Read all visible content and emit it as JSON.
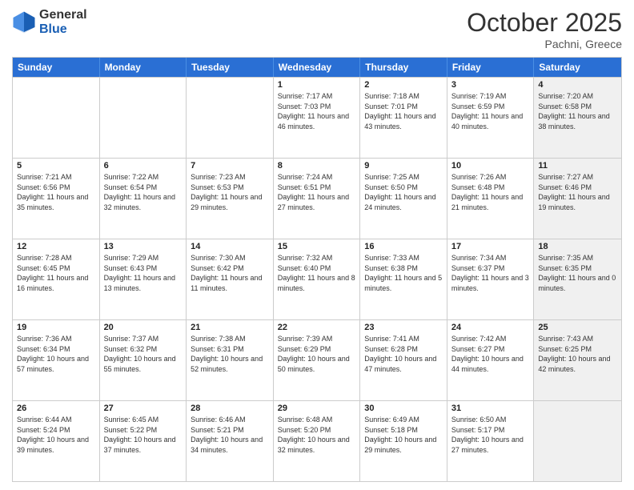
{
  "logo": {
    "general": "General",
    "blue": "Blue"
  },
  "header": {
    "month": "October 2025",
    "location": "Pachni, Greece"
  },
  "days": [
    "Sunday",
    "Monday",
    "Tuesday",
    "Wednesday",
    "Thursday",
    "Friday",
    "Saturday"
  ],
  "rows": [
    [
      {
        "day": "",
        "info": "",
        "shaded": false
      },
      {
        "day": "",
        "info": "",
        "shaded": false
      },
      {
        "day": "",
        "info": "",
        "shaded": false
      },
      {
        "day": "1",
        "info": "Sunrise: 7:17 AM\nSunset: 7:03 PM\nDaylight: 11 hours and 46 minutes.",
        "shaded": false
      },
      {
        "day": "2",
        "info": "Sunrise: 7:18 AM\nSunset: 7:01 PM\nDaylight: 11 hours and 43 minutes.",
        "shaded": false
      },
      {
        "day": "3",
        "info": "Sunrise: 7:19 AM\nSunset: 6:59 PM\nDaylight: 11 hours and 40 minutes.",
        "shaded": false
      },
      {
        "day": "4",
        "info": "Sunrise: 7:20 AM\nSunset: 6:58 PM\nDaylight: 11 hours and 38 minutes.",
        "shaded": true
      }
    ],
    [
      {
        "day": "5",
        "info": "Sunrise: 7:21 AM\nSunset: 6:56 PM\nDaylight: 11 hours and 35 minutes.",
        "shaded": false
      },
      {
        "day": "6",
        "info": "Sunrise: 7:22 AM\nSunset: 6:54 PM\nDaylight: 11 hours and 32 minutes.",
        "shaded": false
      },
      {
        "day": "7",
        "info": "Sunrise: 7:23 AM\nSunset: 6:53 PM\nDaylight: 11 hours and 29 minutes.",
        "shaded": false
      },
      {
        "day": "8",
        "info": "Sunrise: 7:24 AM\nSunset: 6:51 PM\nDaylight: 11 hours and 27 minutes.",
        "shaded": false
      },
      {
        "day": "9",
        "info": "Sunrise: 7:25 AM\nSunset: 6:50 PM\nDaylight: 11 hours and 24 minutes.",
        "shaded": false
      },
      {
        "day": "10",
        "info": "Sunrise: 7:26 AM\nSunset: 6:48 PM\nDaylight: 11 hours and 21 minutes.",
        "shaded": false
      },
      {
        "day": "11",
        "info": "Sunrise: 7:27 AM\nSunset: 6:46 PM\nDaylight: 11 hours and 19 minutes.",
        "shaded": true
      }
    ],
    [
      {
        "day": "12",
        "info": "Sunrise: 7:28 AM\nSunset: 6:45 PM\nDaylight: 11 hours and 16 minutes.",
        "shaded": false
      },
      {
        "day": "13",
        "info": "Sunrise: 7:29 AM\nSunset: 6:43 PM\nDaylight: 11 hours and 13 minutes.",
        "shaded": false
      },
      {
        "day": "14",
        "info": "Sunrise: 7:30 AM\nSunset: 6:42 PM\nDaylight: 11 hours and 11 minutes.",
        "shaded": false
      },
      {
        "day": "15",
        "info": "Sunrise: 7:32 AM\nSunset: 6:40 PM\nDaylight: 11 hours and 8 minutes.",
        "shaded": false
      },
      {
        "day": "16",
        "info": "Sunrise: 7:33 AM\nSunset: 6:38 PM\nDaylight: 11 hours and 5 minutes.",
        "shaded": false
      },
      {
        "day": "17",
        "info": "Sunrise: 7:34 AM\nSunset: 6:37 PM\nDaylight: 11 hours and 3 minutes.",
        "shaded": false
      },
      {
        "day": "18",
        "info": "Sunrise: 7:35 AM\nSunset: 6:35 PM\nDaylight: 11 hours and 0 minutes.",
        "shaded": true
      }
    ],
    [
      {
        "day": "19",
        "info": "Sunrise: 7:36 AM\nSunset: 6:34 PM\nDaylight: 10 hours and 57 minutes.",
        "shaded": false
      },
      {
        "day": "20",
        "info": "Sunrise: 7:37 AM\nSunset: 6:32 PM\nDaylight: 10 hours and 55 minutes.",
        "shaded": false
      },
      {
        "day": "21",
        "info": "Sunrise: 7:38 AM\nSunset: 6:31 PM\nDaylight: 10 hours and 52 minutes.",
        "shaded": false
      },
      {
        "day": "22",
        "info": "Sunrise: 7:39 AM\nSunset: 6:29 PM\nDaylight: 10 hours and 50 minutes.",
        "shaded": false
      },
      {
        "day": "23",
        "info": "Sunrise: 7:41 AM\nSunset: 6:28 PM\nDaylight: 10 hours and 47 minutes.",
        "shaded": false
      },
      {
        "day": "24",
        "info": "Sunrise: 7:42 AM\nSunset: 6:27 PM\nDaylight: 10 hours and 44 minutes.",
        "shaded": false
      },
      {
        "day": "25",
        "info": "Sunrise: 7:43 AM\nSunset: 6:25 PM\nDaylight: 10 hours and 42 minutes.",
        "shaded": true
      }
    ],
    [
      {
        "day": "26",
        "info": "Sunrise: 6:44 AM\nSunset: 5:24 PM\nDaylight: 10 hours and 39 minutes.",
        "shaded": false
      },
      {
        "day": "27",
        "info": "Sunrise: 6:45 AM\nSunset: 5:22 PM\nDaylight: 10 hours and 37 minutes.",
        "shaded": false
      },
      {
        "day": "28",
        "info": "Sunrise: 6:46 AM\nSunset: 5:21 PM\nDaylight: 10 hours and 34 minutes.",
        "shaded": false
      },
      {
        "day": "29",
        "info": "Sunrise: 6:48 AM\nSunset: 5:20 PM\nDaylight: 10 hours and 32 minutes.",
        "shaded": false
      },
      {
        "day": "30",
        "info": "Sunrise: 6:49 AM\nSunset: 5:18 PM\nDaylight: 10 hours and 29 minutes.",
        "shaded": false
      },
      {
        "day": "31",
        "info": "Sunrise: 6:50 AM\nSunset: 5:17 PM\nDaylight: 10 hours and 27 minutes.",
        "shaded": false
      },
      {
        "day": "",
        "info": "",
        "shaded": true
      }
    ]
  ]
}
